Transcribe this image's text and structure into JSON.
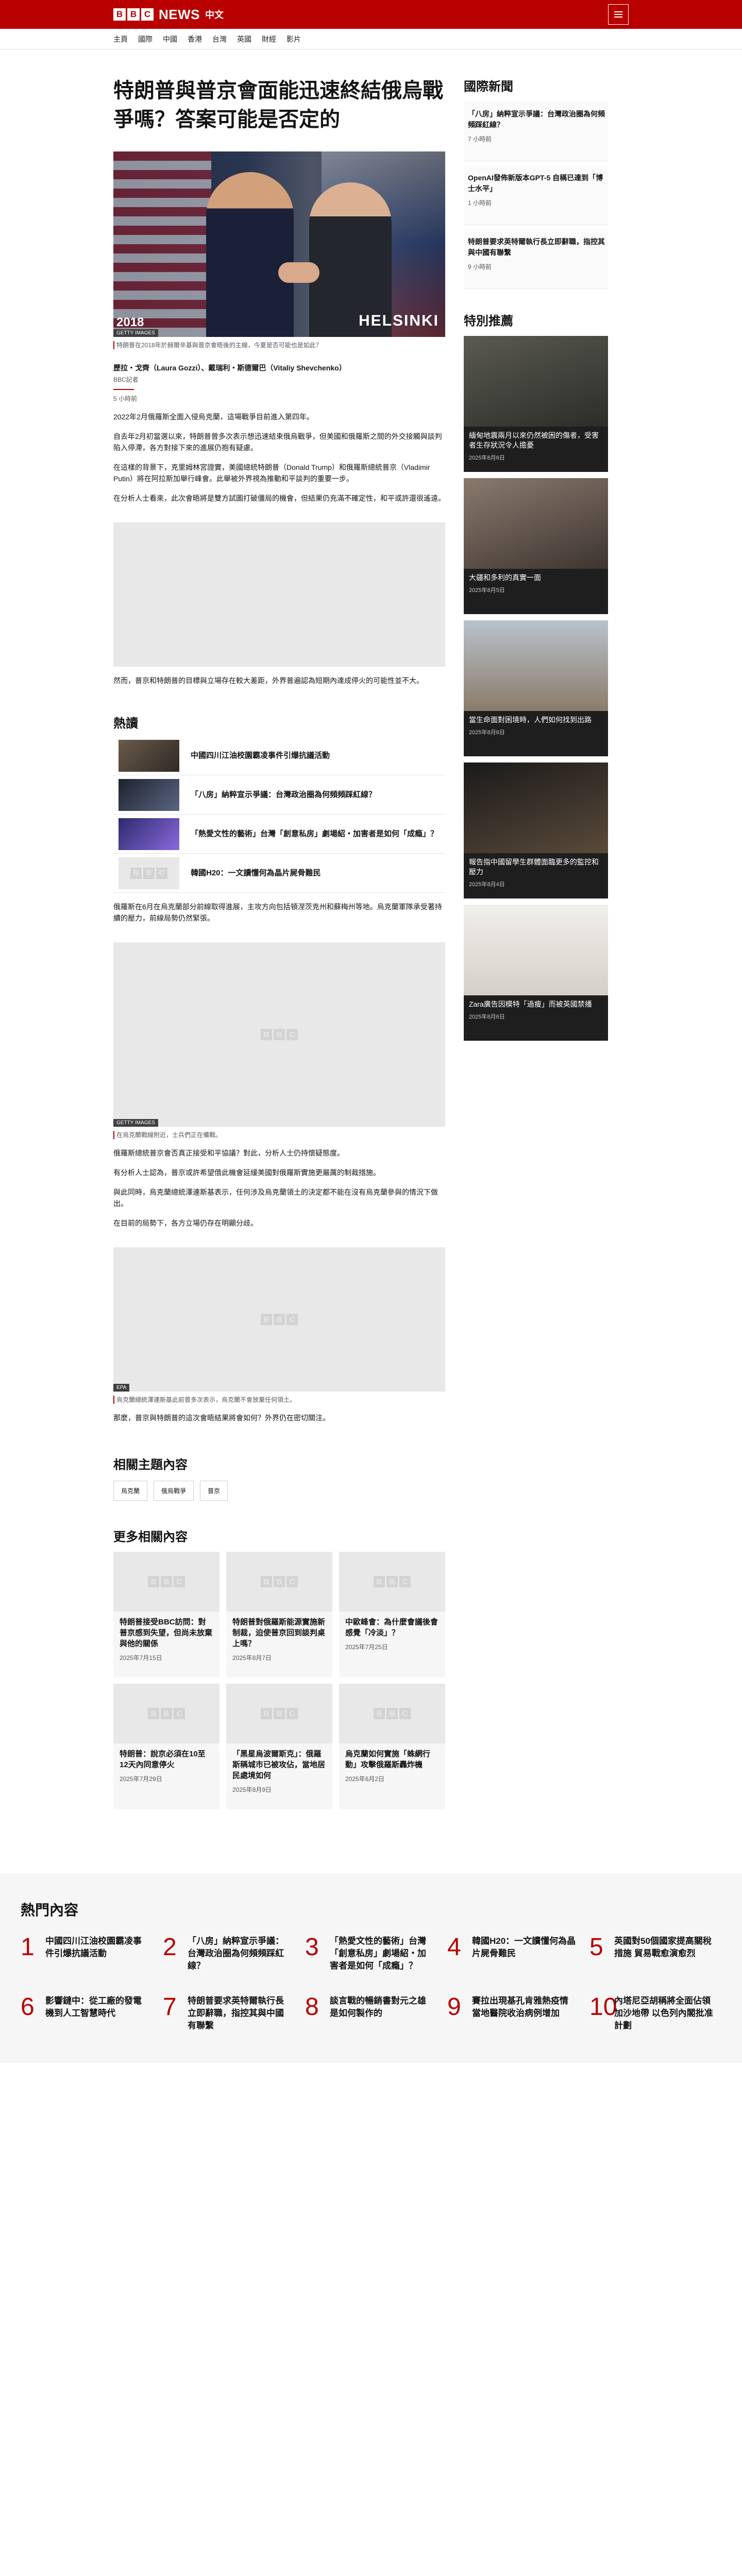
{
  "header": {
    "brand_letters": [
      "B",
      "B",
      "C"
    ],
    "brand_word": "NEWS",
    "language": "中文",
    "menu_icon": "menu-icon"
  },
  "nav": {
    "items": [
      "主頁",
      "國際",
      "中國",
      "香港",
      "台灣",
      "英國",
      "財經",
      "影片"
    ]
  },
  "article": {
    "headline": "特朗普與普京會面能迅速終結俄烏戰爭嗎？答案可能是否定的",
    "hero": {
      "year": "2018",
      "location": "HELSINKI",
      "credit": "GETTY IMAGES",
      "caption": "特朗普在2018年於赫爾辛基與普京會晤後的主線，今夏是否可能也是如此？"
    },
    "byline": {
      "names": "歷拉・戈齊（Laura Gozzi）、戴瑞利・斯德爾巴（Vitaliy Shevchenko）",
      "org": "BBC記者",
      "date": "5 小時前"
    },
    "paragraphs": [
      "2022年2月俄羅斯全面入侵烏克蘭，這場戰爭目前進入第四年。",
      "自去年2月初當選以來，特朗普曾多次表示想迅速結束俄烏戰爭，但美國和俄羅斯之間的外交接觸與談判陷入停滯，各方對接下來的進展仍抱有疑慮。",
      "在這樣的背景下，克里姆林宮證實，美國總統特朗普（Donald Trump）和俄羅斯總統普京（Vladimir Putin）將在阿拉斯加舉行峰會。此舉被外界視為推動和平談判的重要一步。",
      "在分析人士看來，此次會晤將是雙方試圖打破僵局的機會，但結果仍充滿不確定性，和平或許還很遙遠。"
    ],
    "after_ad_paragraph": "然而，普京和特朗普的目標與立場存在較大差距，外界普遍認為短期內達成停火的可能性並不大。"
  },
  "hot": {
    "heading": "熱讀",
    "items": [
      "中國四川江油校園霸凌事件引爆抗議活動",
      "「八房」納粹宣示爭議：台灣政治圈為何頻頻踩紅線？",
      "「熱愛文性的藝術」台灣「創意私房」劇場紹・加害者是如何「成瘾」？",
      "韓國H20：一文讀懂何為晶片屍骨難民"
    ]
  },
  "article_body": {
    "paragraphs_1": [
      "俄羅斯在6月在烏克蘭部分前線取得進展，主攻方向包括頓涅茨克州和蘇梅州等地。烏克蘭軍隊承受著持續的壓力，前線局勢仍然緊張。"
    ],
    "inline_image": {
      "credit": "GETTY IMAGES",
      "caption": "在烏克蘭戰線附近，士兵們正在備戰。"
    },
    "paragraphs_2": [
      "俄羅斯總統普京會否真正接受和平協議？對此，分析人士仍持懷疑態度。",
      "有分析人士認為，普京或許希望借此機會延緩美國對俄羅斯實施更嚴厲的制裁措施。",
      "與此同時，烏克蘭總統澤連斯基表示，任何涉及烏克蘭領土的決定都不能在沒有烏克蘭參與的情況下做出。",
      "在目前的局勢下，各方立場仍存在明顯分歧。"
    ],
    "inline_image_2": {
      "credit": "EPA",
      "caption": "烏克蘭總統澤連斯基此前曾多次表示，烏克蘭不會放棄任何領土。"
    },
    "paragraphs_3": [
      "那麼，普京與特朗普的這次會晤結果將會如何？外界仍在密切關注。"
    ]
  },
  "related_topics": {
    "heading": "相關主題內容",
    "items": [
      "烏克蘭",
      "俄烏戰爭",
      "普京"
    ]
  },
  "more": {
    "heading": "更多相關內容",
    "items": [
      {
        "title": "特朗普接受BBC訪問：對普京感到失望，但尚未放棄與他的關係",
        "date": "2025年7月15日"
      },
      {
        "title": "特朗普對俄羅斯能源實施新制裁，迫使普京回到談判桌上嗎？",
        "date": "2025年8月7日"
      },
      {
        "title": "中歐峰會：為什麼會議後會感覺「冷淡」？",
        "date": "2025年7月25日"
      },
      {
        "title": "特朗普：說京必須在10至12天內同意停火",
        "date": "2025年7月29日"
      },
      {
        "title": "「黑星烏波爾斯克」：俄羅斯稱城市已被攻佔，當地居民處境如何",
        "date": "2025年8月9日"
      },
      {
        "title": "烏克蘭如何實施「蛛網行動」攻擊俄羅斯轟炸機",
        "date": "2025年6月2日"
      }
    ]
  },
  "sidebar": {
    "news_heading": "國際新聞",
    "news": [
      {
        "title": "「八房」納粹宣示爭議：台灣政治圈為何頻頻踩紅線？",
        "date": "7 小時前"
      },
      {
        "title": "OpenAI發佈新版本GPT-5 自稱已達到「博士水平」",
        "date": "1 小時前"
      },
      {
        "title": "特朗普要求英特爾執行長立即辭職，指控其與中國有聯繫",
        "date": "9 小時前"
      }
    ],
    "featured_heading": "特別推薦",
    "featured": [
      {
        "title": "緬甸地震兩月以來仍然被困的傷者，受害者生存狀況令人擔憂",
        "date": "2025年8月6日"
      },
      {
        "title": "大疆和多利的真實一面",
        "date": "2025年8月5日"
      },
      {
        "title": "當生命面對困境時，人們如何找到出路",
        "date": "2025年8月6日"
      },
      {
        "title": "報告指中國留學生群體面臨更多的監控和壓力",
        "date": "2025年8月4日"
      },
      {
        "title": "Zara廣告因模特「過瘦」而被英國禁播",
        "date": "2025年8月6日"
      }
    ]
  },
  "popular": {
    "heading": "熱門內容",
    "items": [
      {
        "num": "1",
        "title": "中國四川江油校園霸凌事件引爆抗議活動"
      },
      {
        "num": "2",
        "title": "「八房」納粹宣示爭議：台灣政治圈為何頻頻踩紅線？"
      },
      {
        "num": "3",
        "title": "「熱愛文性的藝術」台灣「創意私房」劇場紹・加害者是如何「成瘾」？"
      },
      {
        "num": "4",
        "title": "韓國H20：一文讀懂何為晶片屍骨難民"
      },
      {
        "num": "5",
        "title": "英國對50個國家提高關稅措施 貿易戰愈演愈烈"
      },
      {
        "num": "6",
        "title": "影響鏈中：從工廠的發電機到人工智慧時代"
      },
      {
        "num": "7",
        "title": "特朗普要求英特爾執行長立即辭職，指控其與中國有聯繫"
      },
      {
        "num": "8",
        "title": "談言戰的暢銷書對元之雄是如何製作的"
      },
      {
        "num": "9",
        "title": "賽拉出現基孔肯雅熱疫情 當地醫院收治病例增加"
      },
      {
        "num": "10",
        "title": "內塔尼亞胡稱將全面佔領加沙地帶 以色列內閣批准計劃"
      }
    ]
  },
  "colors": {
    "brand_red": "#b80000",
    "popular_number": "#b80000"
  }
}
